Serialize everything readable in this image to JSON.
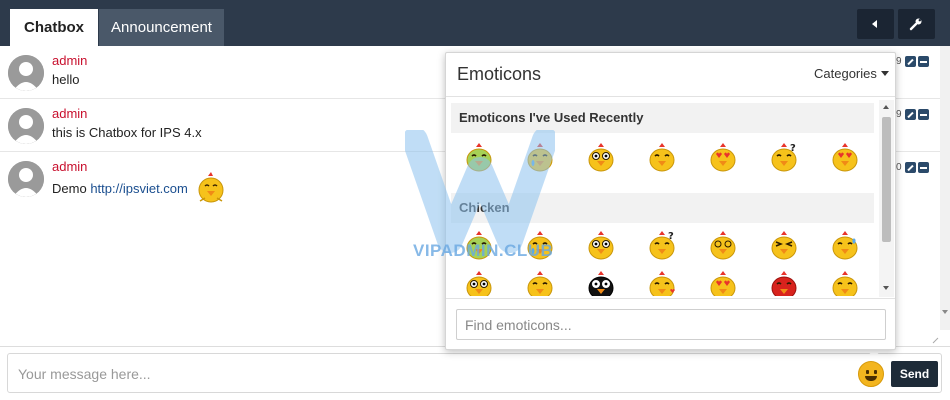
{
  "header": {
    "tabs": [
      {
        "label": "Chatbox",
        "active": true
      },
      {
        "label": "Announcement",
        "active": false
      }
    ],
    "buttons": [
      {
        "icon": "caret-left-icon"
      },
      {
        "icon": "wrench-icon"
      }
    ]
  },
  "messages": [
    {
      "author": "admin",
      "text": "hello",
      "count": "9"
    },
    {
      "author": "admin",
      "text": "this is Chatbox for IPS 4.x",
      "count": "9"
    },
    {
      "author": "admin",
      "text_prefix": "Demo",
      "link": "http://ipsviet.com",
      "count": "0",
      "emoticon": "chicken-happy"
    }
  ],
  "composer": {
    "placeholder": "Your message here...",
    "send_label": "Send"
  },
  "emoticons": {
    "title": "Emoticons",
    "categories_label": "Categories",
    "sections": [
      {
        "title": "Emoticons I've Used Recently",
        "items": [
          "chicken-sick",
          "chicken-crying",
          "chicken-wide-eyes",
          "chicken-sleepy",
          "chicken-love",
          "chicken-confused",
          "chicken-angry-love"
        ]
      },
      {
        "title": "Chicken",
        "items": [
          "chicken-sick",
          "chicken-crying",
          "chicken-wide-eyes",
          "chicken-confused",
          "chicken-dizzy",
          "chicken-annoyed",
          "chicken-sweat",
          "chicken-shocked",
          "chicken-laughing",
          "chicken-black",
          "chicken-kiss",
          "chicken-love",
          "chicken-red-angry",
          "chicken-pouting"
        ]
      }
    ],
    "search_placeholder": "Find emoticons..."
  },
  "watermark": {
    "text": "VIPADMIN.CLUB"
  },
  "colors": {
    "header_bg": "#2d3a4b",
    "author": "#c8102e",
    "accent": "#f3b51f",
    "send_bg": "#1e2b38"
  }
}
